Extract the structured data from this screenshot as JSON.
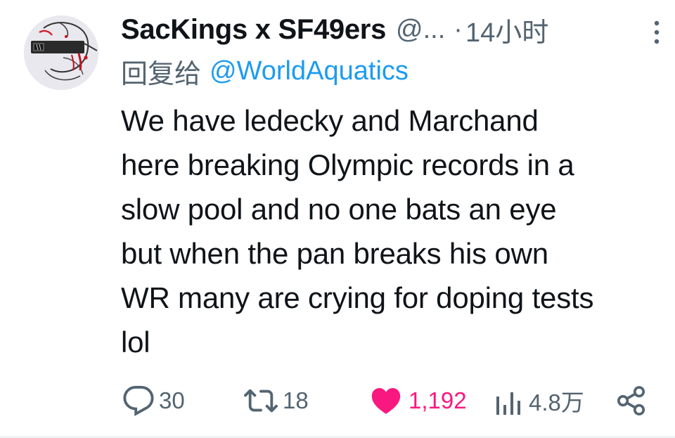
{
  "tweet": {
    "author": {
      "display_name": "SacKings x SF49ers",
      "handle": "@...",
      "avatar_icon": "sketch-avatar-icon"
    },
    "separator": "·",
    "timestamp": "14小时",
    "more_icon": "more-vertical-icon",
    "reply_to": {
      "prefix": "回复给",
      "mention": "@WorldAquatics"
    },
    "text": "We have ledecky and Marchand\nhere breaking Olympic records in a\nslow pool and no one bats an eye\nbut when the pan breaks his own\nWR many are crying for doping tests\nlol",
    "actions": {
      "reply": {
        "icon": "reply-bubble-icon",
        "count": "30"
      },
      "retweet": {
        "icon": "retweet-icon",
        "count": "18"
      },
      "like": {
        "icon": "heart-filled-icon",
        "count": "1,192",
        "liked": true
      },
      "views": {
        "icon": "views-bar-chart-icon",
        "count": "4.8万"
      },
      "share": {
        "icon": "share-icon"
      }
    },
    "colors": {
      "text_primary": "#0f1419",
      "text_secondary": "#536471",
      "link": "#1d9bf0",
      "like": "#f91880"
    }
  }
}
